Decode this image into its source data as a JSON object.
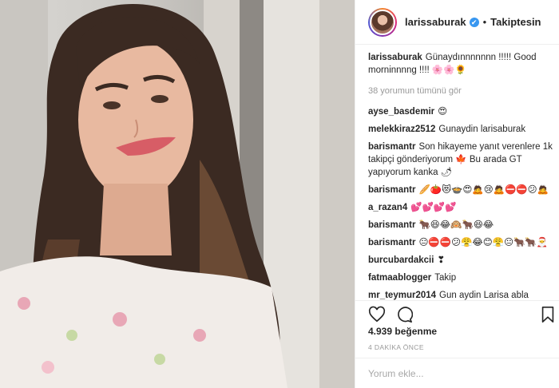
{
  "post": {
    "username": "larissaburak",
    "verified_mark": "✔",
    "separator": "•",
    "follow_state": "Takiptesin",
    "caption_user": "larissaburak",
    "caption_text": "Günaydınnnnnnn !!!!! Good morninnnng !!!! 🌸🌸🌻",
    "load_more": "38 yorumun tümünü gör",
    "likes": "4.939 beğenme",
    "time_ago": "4 DAKİKA ÖNCE",
    "comment_placeholder": "Yorum ekle..."
  },
  "comments": [
    {
      "user": "ayse_basdemir",
      "text": "😍"
    },
    {
      "user": "melekkiraz2512",
      "text": "Gunaydin larisaburak"
    },
    {
      "user": "barismantr",
      "text": "Son hikayeme yanıt verenlere 1k takipçi gönderiyorum 🍁 Bu arada GT yapıyorum kanka 🌶"
    },
    {
      "user": "barismantr",
      "text": "🥖🍅😻🍲😍🙇😢🙇⛔⛔😕🙇"
    },
    {
      "user": "a_razan4",
      "text": "💕💕💕💕"
    },
    {
      "user": "barismantr",
      "text": "🐂😆😂🙉🐂😆😂"
    },
    {
      "user": "barismantr",
      "text": "😐⛔⛔😕😤😂😊😤😐🐂🐂🎅"
    },
    {
      "user": "burcubardakcii",
      "text": "❣"
    },
    {
      "user": "fatmaablogger",
      "text": "Takip"
    },
    {
      "user": "mr_teymur2014",
      "text": "Gun aydin Larisa abla"
    }
  ],
  "icons": {
    "like": "heart-icon",
    "comment": "comment-icon",
    "save": "bookmark-icon"
  },
  "colors": {
    "text": "#262626",
    "muted": "#999999",
    "verified": "#3897f0",
    "border": "#efefef"
  }
}
